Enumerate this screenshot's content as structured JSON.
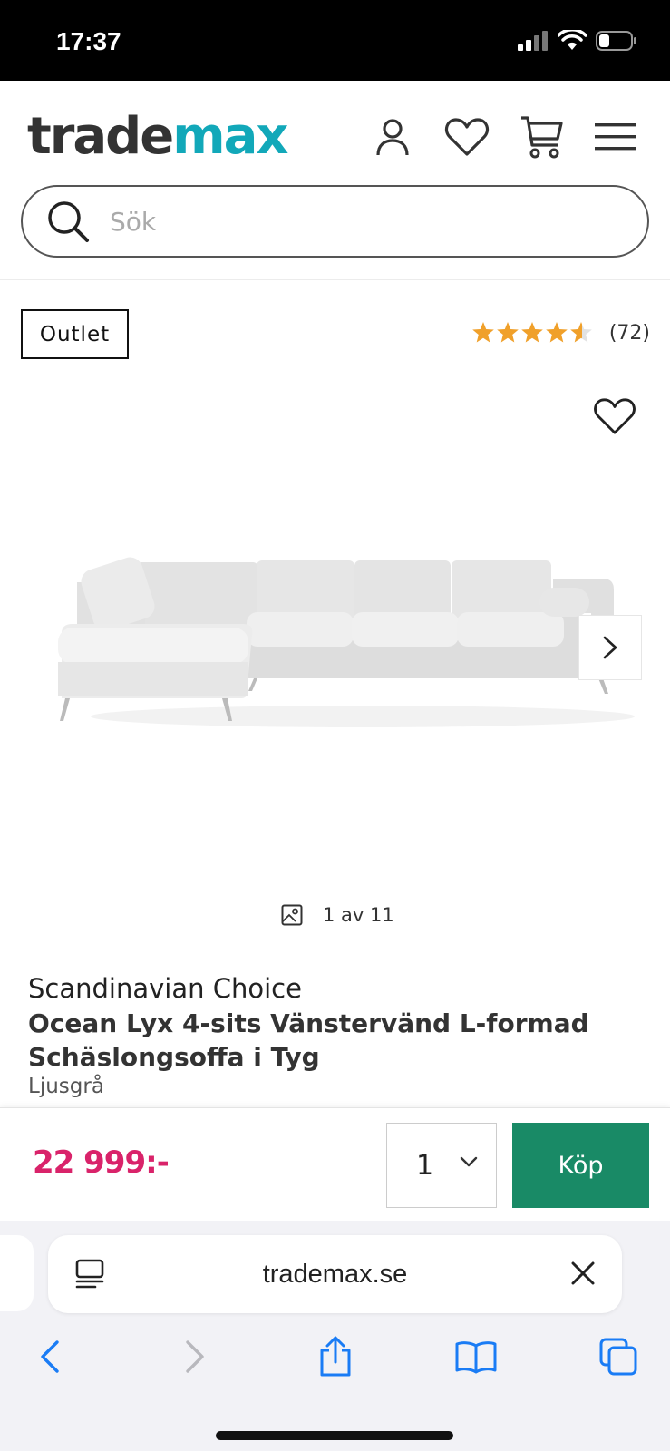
{
  "status_bar": {
    "time": "17:37"
  },
  "header": {
    "logo_part1": "trade",
    "logo_part2": "max",
    "icons": [
      "account-icon",
      "heart-icon",
      "cart-icon",
      "menu-icon"
    ]
  },
  "search": {
    "placeholder": "Sök",
    "value": ""
  },
  "product": {
    "badge": "Outlet",
    "rating": {
      "stars": 4.5,
      "count_label": "(72)"
    },
    "image_counter": "1 av 11",
    "brand": "Scandinavian Choice",
    "title": "Ocean Lyx 4-sits Vänstervänd L-formad Schäslongsoffa i Tyg",
    "variant": "Ljusgrå"
  },
  "buy_bar": {
    "price": "22 999:-",
    "quantity": "1",
    "buy_label": "Köp"
  },
  "browser": {
    "url": "trademax.se",
    "toolbar_icons": [
      "back-icon",
      "forward-icon",
      "share-icon",
      "bookmarks-icon",
      "tabs-icon"
    ]
  },
  "colors": {
    "logo_teal": "#12a8b9",
    "price_pink": "#d9236a",
    "buy_green": "#198a66",
    "star_orange": "#f0a02a",
    "ios_blue": "#1a7cf5"
  }
}
